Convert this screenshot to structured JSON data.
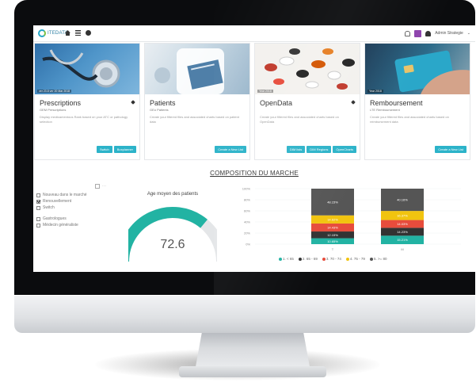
{
  "navbar": {
    "logo_text": "ITEDATA",
    "user_name": "Admin Strategie",
    "caret": "⌄"
  },
  "cards": [
    {
      "caption": "ver 23.8 ver 20 Mar 2018",
      "title": "Prescriptions",
      "subtitle": "GEM Prescriptions",
      "description": "Display medicamentous Rank based on your ATC or pathology selection",
      "buttons": [
        "Switch",
        "Boxplanner"
      ]
    },
    {
      "caption": "",
      "title": "Patients",
      "subtitle": "GEo Patients",
      "description": "Create your filtered files and associated charts based on patient data",
      "buttons": [
        "Create a New List"
      ]
    },
    {
      "caption": "Year 2018",
      "title": "OpenData",
      "subtitle": "",
      "description": "Create your filtered files and associated charts based on OpenData",
      "buttons": [
        "DIM lists",
        "DIM Regions",
        "OpenCharts"
      ]
    },
    {
      "caption": "Year 2018",
      "title": "Remboursement",
      "subtitle": "LTE Remboursement",
      "description": "Create your filtered files and associated charts based on reimbursement data",
      "buttons": [
        "Create a New List"
      ]
    }
  ],
  "section": {
    "title": "COMPOSITION DU MARCHE"
  },
  "filters": {
    "items": [
      {
        "label": "Nouveau dans le marché",
        "checked": false
      },
      {
        "label": "Renouvellement",
        "checked": true
      },
      {
        "label": "Switch",
        "checked": false
      },
      {
        "label": "",
        "checked": false
      },
      {
        "label": "Gastrologues",
        "checked": false
      },
      {
        "label": "Médecin généraliste",
        "checked": false
      }
    ]
  },
  "gauge": {
    "title": "Age moyen des patients",
    "value_label": "72.6",
    "fraction": 0.72,
    "color": "#22b3a3",
    "track_color": "#e4e6e8"
  },
  "chart_data": {
    "type": "bar",
    "stacked": true,
    "categories": [
      "T",
      "M"
    ],
    "y_ticks": [
      "100%",
      "80%",
      "60%",
      "40%",
      "20%",
      "0%"
    ],
    "ylim": [
      0,
      100
    ],
    "series": [
      {
        "name": "1. < 65",
        "color": "#22b3a3",
        "values": [
          10.65,
          15.21
        ]
      },
      {
        "name": "2. 65 - 69",
        "color": "#333333",
        "values": [
          12.15,
          14.23
        ]
      },
      {
        "name": "3. 70 - 74",
        "color": "#e74c3c",
        "values": [
          14.43,
          14.03
        ]
      },
      {
        "name": "4. 75 - 79",
        "color": "#f1c40f",
        "values": [
          14.62,
          16.37
        ]
      },
      {
        "name": "5. >= 80",
        "color": "#555555",
        "values": [
          48.15,
          40.16
        ]
      }
    ],
    "data_labels": [
      [
        "10.65%",
        "12.15%",
        "14.43%",
        "14.62%",
        "48.15%"
      ],
      [
        "15.21%",
        "14.23%",
        "14.03%",
        "16.37%",
        "40.16%"
      ]
    ],
    "legend_position": "bottom"
  }
}
